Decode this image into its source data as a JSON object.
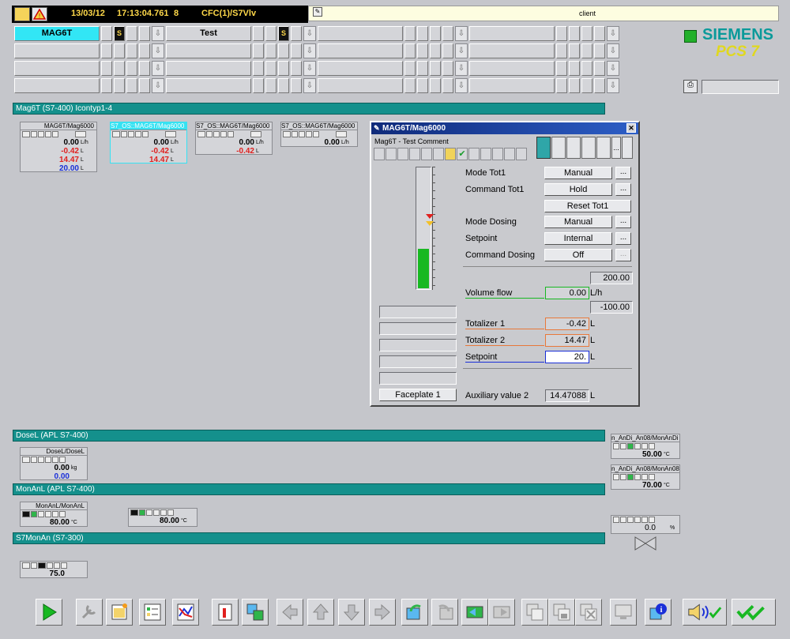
{
  "topbar": {
    "date": "13/03/12",
    "time": "17:13:04.761",
    "count": "8",
    "path": "CFC(1)/S7Vlv",
    "client": "client"
  },
  "nav": {
    "area1": "MAG6T",
    "area2": "Test",
    "s1": "S",
    "s2": "S"
  },
  "brand": {
    "name": "SIEMENS",
    "product": "PCS 7"
  },
  "sections": {
    "mag": "Mag6T  (S7-400) Icontyp1-4",
    "dose": "DoseL (APL S7-400)",
    "monan": "MonAnL (APL S7-400)",
    "s7monan": "S7MonAn (S7-300)"
  },
  "mag_blocks": [
    {
      "title": "MAG6T/Mag6000",
      "v1": "0.00",
      "u1": "L/h",
      "v2": "-0.42",
      "u2": "L",
      "v3": "14.47",
      "u3": "L",
      "v4": "20.00",
      "u4": "L"
    },
    {
      "title": "S7_OS::MAG6T/Mag6000",
      "v1": "0.00",
      "u1": "L/h",
      "v2": "-0.42",
      "u2": "L",
      "v3": "14.47",
      "u3": "L"
    },
    {
      "title": "S7_OS::MAG6T/Mag6000",
      "v1": "0.00",
      "u1": "L/h",
      "v2": "-0.42",
      "u2": "L"
    },
    {
      "title": "S7_OS::MAG6T/Mag6000",
      "v1": "0.00",
      "u1": "L/h"
    }
  ],
  "faceplate": {
    "title": "MAG6T/Mag6000",
    "comment": "Mag6T - Test Comment",
    "close": "✕",
    "rows": {
      "mode_tot1": {
        "label": "Mode Tot1",
        "value": "Manual"
      },
      "cmd_tot1": {
        "label": "Command Tot1",
        "value": "Hold"
      },
      "reset_tot1": {
        "value": "Reset Tot1"
      },
      "mode_dosing": {
        "label": "Mode Dosing",
        "value": "Manual"
      },
      "setpoint_sel": {
        "label": "Setpoint",
        "value": "Internal"
      },
      "cmd_dosing": {
        "label": "Command Dosing",
        "value": "Off"
      }
    },
    "dots": "...",
    "high_limit": "200.00",
    "low_limit": "-100.00",
    "volume_flow": {
      "label": "Volume flow",
      "value": "0.00",
      "unit": "L/h"
    },
    "totalizer1": {
      "label": "Totalizer 1",
      "value": "-0.42",
      "unit": "L"
    },
    "totalizer2": {
      "label": "Totalizer 2",
      "value": "14.47",
      "unit": "L"
    },
    "setpoint": {
      "label": "Setpoint",
      "value": "20.",
      "unit": "L"
    },
    "aux2": {
      "label": "Auxiliary value 2",
      "value": "14.47088",
      "unit": "L"
    },
    "faceplate_btn": "Faceplate 1",
    "bar_fill_fraction": 0.33
  },
  "dose_block": {
    "title": "DoseL/DoseL",
    "v1": "0.00",
    "v2": "0.00",
    "unit": "kg"
  },
  "monan_block1": {
    "title": "MonAnL/MonAnL",
    "value": "80.00",
    "unit": "°C"
  },
  "monan_block2": {
    "value": "80.00",
    "unit": "°C"
  },
  "right_blocks": [
    {
      "title": "n_AnDi_An08/MonAnDi",
      "value": "50.00",
      "unit": "°C"
    },
    {
      "title": "n_AnDi_An08/MonAn08",
      "value": "70.00",
      "unit": "°C"
    }
  ],
  "valve": {
    "value": "0.0",
    "unit": "%"
  },
  "s7monan_block": {
    "value": "75.0"
  },
  "colors": {
    "accent": "#14908c",
    "active_tab": "#32e6f5",
    "red": "#e0201e",
    "blue": "#1a2fd8"
  }
}
